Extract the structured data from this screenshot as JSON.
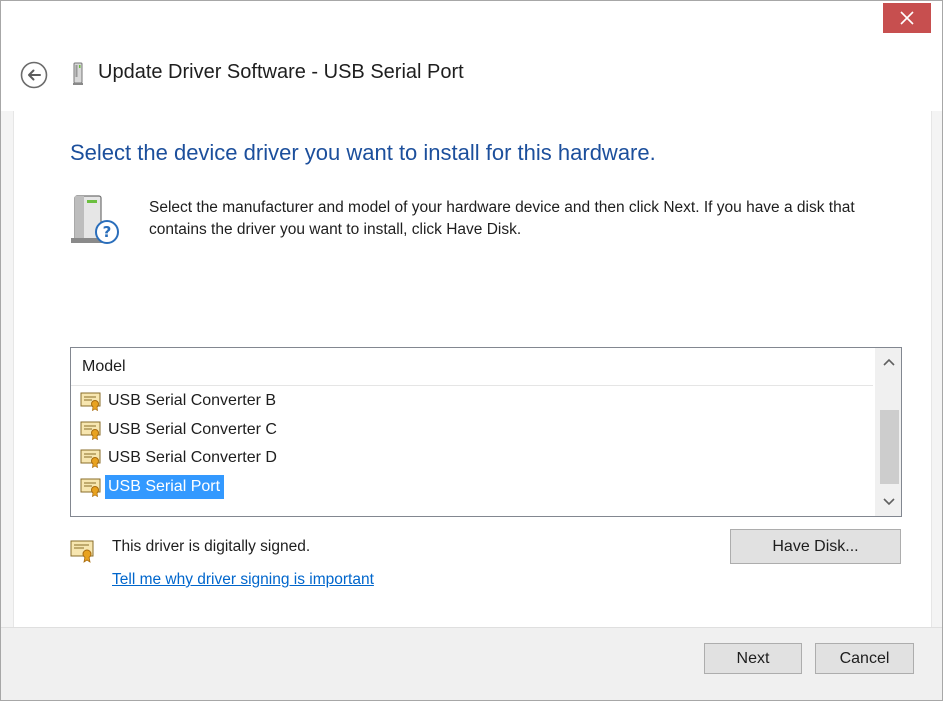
{
  "window": {
    "title": "Update Driver Software - USB Serial Port"
  },
  "main": {
    "heading": "Select the device driver you want to install for this hardware.",
    "description": "Select the manufacturer and model of your hardware device and then click Next. If you have a disk that contains the driver you want to install, click Have Disk."
  },
  "list": {
    "header": "Model",
    "items": [
      {
        "label": "USB Serial Converter B"
      },
      {
        "label": "USB Serial Converter C"
      },
      {
        "label": "USB Serial Converter D"
      },
      {
        "label": "USB Serial Port"
      }
    ],
    "selected": "USB Serial Port",
    "scroll_position": 0.85
  },
  "signing": {
    "status": "This driver is digitally signed.",
    "link": "Tell me why driver signing is important"
  },
  "buttons": {
    "have_disk": "Have Disk...",
    "next": "Next",
    "cancel": "Cancel"
  },
  "colors": {
    "heading": "#1c4f9c",
    "selection": "#3399ff",
    "link": "#0066cc",
    "close": "#c74f4f"
  },
  "icons": {
    "close": "close-icon",
    "back": "back-arrow-icon",
    "device": "hardware-device-icon",
    "model": "certificate-icon",
    "signed": "signed-certificate-icon"
  }
}
